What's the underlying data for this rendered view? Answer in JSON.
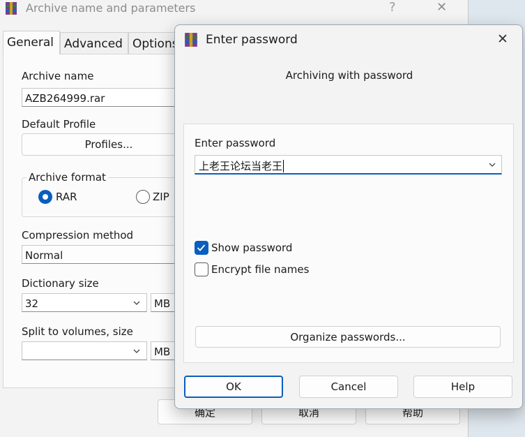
{
  "background_dialog": {
    "title": "Archive name and parameters",
    "help_glyph": "?",
    "close_glyph": "✕",
    "tabs": [
      "General",
      "Advanced",
      "Options"
    ],
    "archive_name_label": "Archive name",
    "archive_name_value": "AZB264999.rar",
    "default_profile_label": "Default Profile",
    "profiles_button": "Profiles...",
    "archive_format_label": "Archive format",
    "format_options": [
      "RAR",
      "ZIP"
    ],
    "selected_format": "RAR",
    "compression_method_label": "Compression method",
    "compression_method_value": "Normal",
    "dictionary_size_label": "Dictionary size",
    "dictionary_size_value": "32",
    "dictionary_unit": "MB",
    "split_volumes_label": "Split to volumes, size",
    "split_volumes_value": "",
    "split_unit": "MB",
    "buttons": [
      "确定",
      "取消",
      "帮助"
    ]
  },
  "password_dialog": {
    "title": "Enter password",
    "close_glyph": "✕",
    "subtitle": "Archiving with password",
    "enter_password_label": "Enter password",
    "password_value": "上老王论坛当老王",
    "show_password_label": "Show password",
    "show_password_checked": true,
    "encrypt_names_label": "Encrypt file names",
    "encrypt_names_checked": false,
    "organize_button": "Organize passwords...",
    "ok_button": "OK",
    "cancel_button": "Cancel",
    "help_button": "Help"
  },
  "colors": {
    "accent": "#0a5ebd",
    "dialog_bg": "#f3f3f3",
    "panel_bg": "#fbfbfb"
  }
}
